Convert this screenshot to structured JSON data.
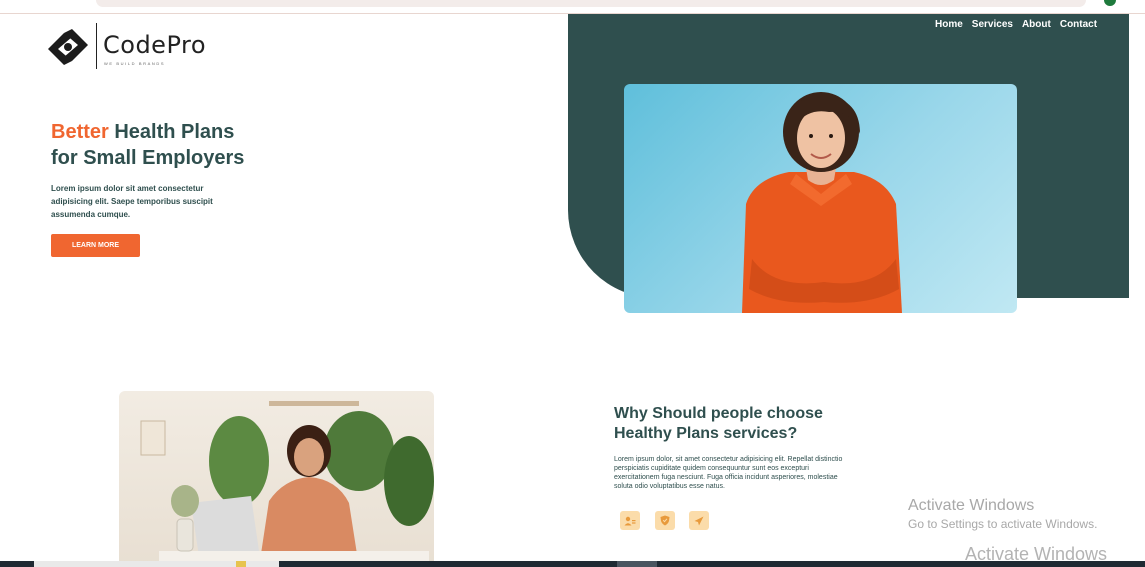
{
  "logo": {
    "name": "CodePro",
    "tagline": "WE BUILD BRANDS"
  },
  "nav": [
    "Home",
    "Services",
    "About",
    "Contact"
  ],
  "hero": {
    "title_accent": "Better",
    "title_rest": " Health Plans",
    "title_line2": "for Small Employers",
    "description": "Lorem ipsum dolor sit amet consectetur adipisicing elit. Saepe temporibus suscipit assumenda cumque.",
    "cta": "LEARN MORE",
    "image_alt": "smiling woman in orange shirt"
  },
  "why": {
    "title_line1": "Why Should people choose",
    "title_line2": "Healthy Plans services?",
    "description": "Lorem ipsum dolor, sit amet consectetur adipisicing elit. Repellat distinctio perspiciatis cupiditate quidem consequuntur sunt eos excepturi exercitationem fuga nesciunt. Fuga officia incidunt asperiores, molestiae soluta odio voluptatibus esse natus.",
    "features": [
      "user-icon",
      "shield-icon",
      "rocket-icon"
    ],
    "image_alt": "woman working on laptop at home"
  },
  "watermark": {
    "line1": "Activate Windows",
    "line2": "Go to Settings to activate Windows.",
    "line3": "Activate Windows"
  },
  "colors": {
    "accent": "#f06630",
    "dark_teal": "#2f4f4e",
    "feature_bg": "#fbdcaa"
  }
}
